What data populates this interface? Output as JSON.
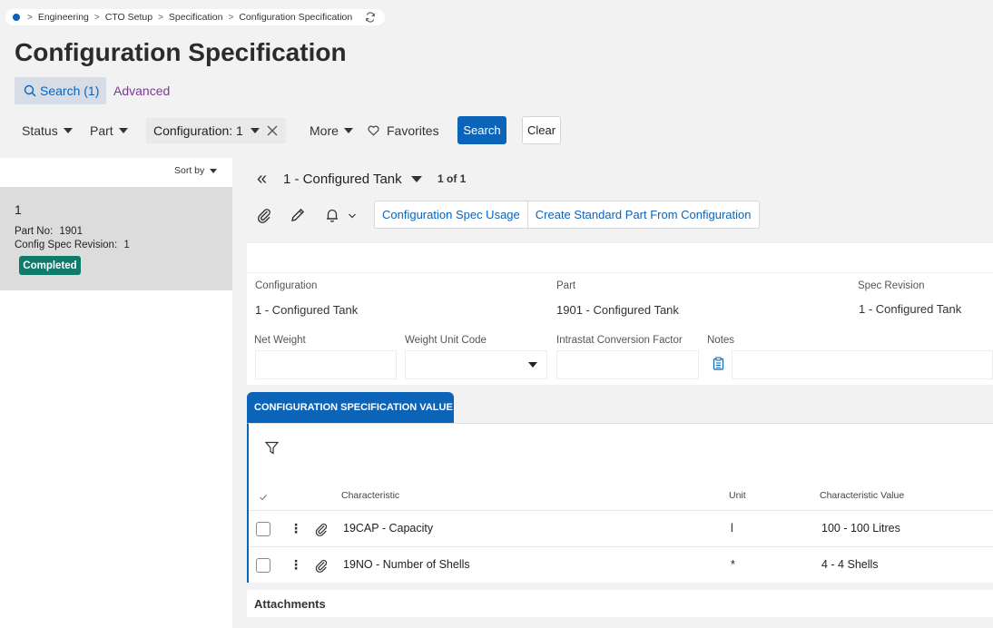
{
  "breadcrumb": {
    "items": [
      "Engineering",
      "CTO Setup",
      "Specification",
      "Configuration Specification"
    ],
    "separator": ">",
    "refresh_icon": "refresh-icon"
  },
  "page": {
    "title": "Configuration Specification"
  },
  "search_tabs": {
    "search_label": "Search (1)",
    "advanced_label": "Advanced"
  },
  "filters": {
    "status_label": "Status",
    "part_label": "Part",
    "configuration_label": "Configuration: 1",
    "more_label": "More",
    "favorites_label": "Favorites",
    "search_button": "Search",
    "clear_button": "Clear"
  },
  "list": {
    "sort_label": "Sort by",
    "record": {
      "title": "1",
      "part_no_label": "Part No:",
      "part_no": "1901",
      "revision_label": "Config Spec Revision:",
      "revision": "1",
      "status_badge": "Completed"
    }
  },
  "detail": {
    "record_selector": "1 - Configured Tank",
    "record_count": "1 of 1",
    "commands": [
      "Configuration Spec Usage",
      "Create Standard Part From Configuration"
    ],
    "fields": {
      "configuration_label": "Configuration",
      "configuration_value": "1 - Configured Tank",
      "part_label": "Part",
      "part_value": "1901 - Configured Tank",
      "spec_revision_label": "Spec Revision",
      "spec_revision_value": "1 - Configured Tank",
      "net_weight_label": "Net Weight",
      "weight_unit_label": "Weight Unit Code",
      "intrastat_label": "Intrastat Conversion Factor",
      "notes_label": "Notes"
    }
  },
  "grid": {
    "tab_label": "CONFIGURATION SPECIFICATION VALUE",
    "columns": [
      "Characteristic",
      "Unit",
      "Characteristic Value"
    ],
    "rows": [
      {
        "characteristic": "19CAP - Capacity",
        "unit": "l",
        "value": "100 - 100 Litres"
      },
      {
        "characteristic": "19NO - Number of Shells",
        "unit": "*",
        "value": "4 - 4 Shells"
      }
    ]
  },
  "attachments": {
    "label": "Attachments"
  },
  "colors": {
    "accent": "#0b64b8",
    "badge": "#0f7b6c",
    "advanced": "#7a3b8c"
  }
}
